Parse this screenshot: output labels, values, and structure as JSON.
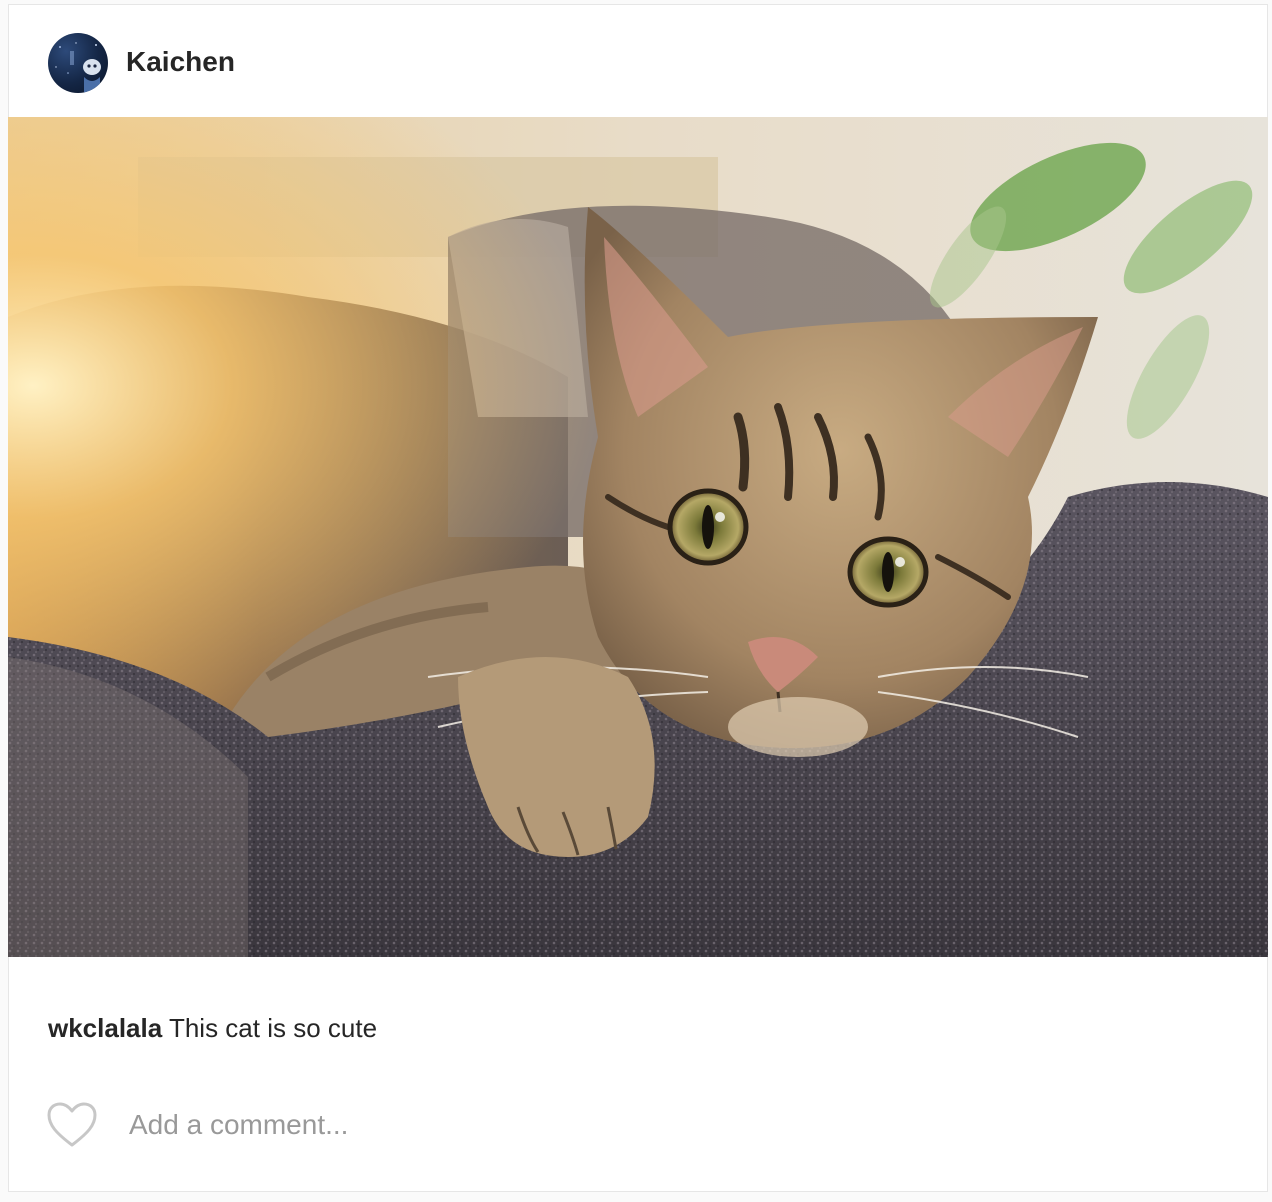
{
  "post": {
    "author": "Kaichen",
    "avatar_icon": "profile-avatar-icon",
    "image_icon": "cat-photo",
    "caption": {
      "username": "wkclalala",
      "text": "This cat is so cute"
    },
    "like_icon": "heart-outline-icon",
    "comment_placeholder": "Add a comment..."
  },
  "colors": {
    "text": "#262626",
    "placeholder": "#999999",
    "border": "#e6e6e6",
    "heart_stroke": "#c7c7c7"
  }
}
